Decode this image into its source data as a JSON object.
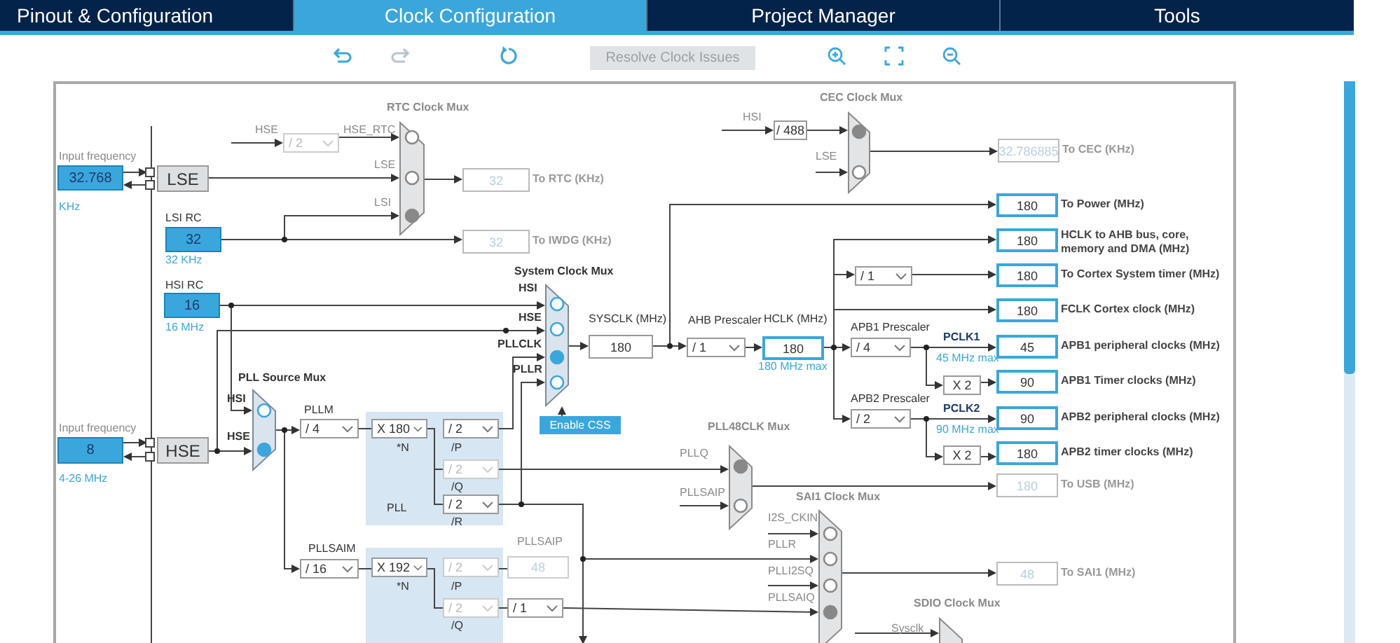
{
  "tabs": [
    {
      "label": "Pinout & Configuration",
      "selected": false
    },
    {
      "label": "Clock Configuration",
      "selected": true
    },
    {
      "label": "Project Manager",
      "selected": false
    },
    {
      "label": "Tools",
      "selected": false
    }
  ],
  "toolbar": {
    "resolve_button": {
      "label": "Resolve Clock Issues",
      "disabled": true
    }
  },
  "sources": [
    {
      "kind": "external",
      "title": "Input frequency",
      "value": "32.768",
      "unit": "KHz",
      "name": "LSE"
    },
    {
      "kind": "rc",
      "title": "LSI RC",
      "value": "32",
      "unit": "32 KHz"
    },
    {
      "kind": "rc",
      "title": "HSI RC",
      "value": "16",
      "unit": "16 MHz"
    },
    {
      "kind": "external",
      "title": "Input frequency",
      "value": "8",
      "unit": "4-26 MHz",
      "name": "HSE"
    }
  ],
  "muxes": [
    {
      "title": "RTC Clock Mux",
      "active": false,
      "inputs": [
        {
          "label": "HSE_RTC",
          "selected": false
        },
        {
          "label": "LSE",
          "selected": false
        },
        {
          "label": "LSI",
          "selected": true
        }
      ]
    },
    {
      "title": "CEC Clock Mux",
      "active": false,
      "inputs": [
        {
          "label": "HSI",
          "selected": true
        },
        {
          "label": "LSE",
          "selected": false
        }
      ]
    },
    {
      "title": "System Clock Mux",
      "active": true,
      "inputs": [
        {
          "label": "HSI",
          "selected": false
        },
        {
          "label": "HSE",
          "selected": false
        },
        {
          "label": "PLLCLK",
          "selected": true
        },
        {
          "label": "PLLR",
          "selected": false
        }
      ]
    },
    {
      "title": "PLL Source Mux",
      "active": true,
      "inputs": [
        {
          "label": "HSI",
          "selected": false
        },
        {
          "label": "HSE",
          "selected": true
        }
      ]
    },
    {
      "title": "PLL48CLK Mux",
      "active": false,
      "inputs": [
        {
          "label": "PLLQ",
          "selected": true
        },
        {
          "label": "PLLSAIP",
          "selected": false
        }
      ]
    },
    {
      "title": "SAI1 Clock Mux",
      "active": false,
      "inputs": [
        {
          "label": "I2S_CKIN",
          "selected": false
        },
        {
          "label": "PLLR",
          "selected": false
        },
        {
          "label": "PLLI2SQ",
          "selected": false
        },
        {
          "label": "PLLSAIQ",
          "selected": true
        }
      ]
    },
    {
      "title": "SDIO Clock Mux",
      "inputs": [
        {
          "label": "Sysclk"
        }
      ]
    }
  ],
  "dividers": [
    {
      "kind": "dropdown",
      "input_label": "HSE",
      "value": "/ 2",
      "disabled": true
    },
    {
      "kind": "fixed",
      "value": "/ 488",
      "disabled": false
    },
    {
      "kind": "dropdown",
      "title": "AHB Prescaler",
      "value": "/ 1",
      "disabled": false
    },
    {
      "kind": "dropdown",
      "value": "/ 1",
      "disabled": false
    },
    {
      "kind": "dropdown",
      "title": "APB1 Prescaler",
      "value": "/ 4",
      "disabled": false
    },
    {
      "kind": "dropdown",
      "title": "APB2 Prescaler",
      "value": "/ 2",
      "disabled": false
    },
    {
      "kind": "dropdown",
      "title": "PLLM",
      "value": "/ 4",
      "disabled": false
    },
    {
      "kind": "dropdown",
      "value": "X 180",
      "caption": "*N",
      "disabled": false
    },
    {
      "kind": "dropdown",
      "value": "/ 2",
      "caption": "/P",
      "disabled": false
    },
    {
      "kind": "dropdown",
      "value": "/ 2",
      "caption": "/Q",
      "disabled": true
    },
    {
      "kind": "dropdown",
      "value": "/ 2",
      "caption": "/R",
      "disabled": false
    },
    {
      "kind": "dropdown",
      "title": "PLLSAIM",
      "value": "/ 16",
      "disabled": false
    },
    {
      "kind": "dropdown",
      "value": "X 192",
      "caption": "*N",
      "disabled": false
    },
    {
      "kind": "dropdown",
      "value": "/ 2",
      "caption": "/P",
      "disabled": true
    },
    {
      "kind": "dropdown",
      "value": "/ 2",
      "caption": "/Q",
      "disabled": true
    },
    {
      "kind": "dropdown",
      "value": "/ 1",
      "disabled": false
    }
  ],
  "values": [
    {
      "title": "SYSCLK (MHz)",
      "value": "180",
      "highlighted": false,
      "disabled": false
    },
    {
      "title": "HCLK (MHz)",
      "value": "180",
      "note": "180 MHz max",
      "highlighted": true,
      "disabled": false
    },
    {
      "title": "PLLSAIP",
      "value": "48",
      "highlighted": false,
      "disabled": true
    }
  ],
  "pclk": [
    {
      "label": "PCLK1",
      "note": "45 MHz max"
    },
    {
      "label": "PCLK2",
      "note": "90 MHz max"
    }
  ],
  "multipliers": [
    "X 2",
    "X 2"
  ],
  "pll_label": "PLL",
  "enable_css": "Enable CSS",
  "outputs": [
    {
      "value": "32",
      "label": "To RTC (KHz)",
      "disabled": true
    },
    {
      "value": "32",
      "label": "To IWDG (KHz)",
      "disabled": true
    },
    {
      "value": "32.786885",
      "label": "To CEC (KHz)",
      "disabled": true
    },
    {
      "value": "180",
      "label": "To Power (MHz)",
      "disabled": false
    },
    {
      "value": "180",
      "label": "HCLK to AHB bus, core, memory and DMA (MHz)",
      "disabled": false
    },
    {
      "value": "180",
      "label": "To Cortex System timer (MHz)",
      "disabled": false
    },
    {
      "value": "180",
      "label": "FCLK Cortex clock (MHz)",
      "disabled": false
    },
    {
      "value": "45",
      "label": "APB1 peripheral clocks (MHz)",
      "disabled": false
    },
    {
      "value": "90",
      "label": "APB1 Timer clocks (MHz)",
      "disabled": false
    },
    {
      "value": "90",
      "label": "APB2 peripheral clocks (MHz)",
      "disabled": false
    },
    {
      "value": "180",
      "label": "APB2 timer clocks (MHz)",
      "disabled": false
    },
    {
      "value": "180",
      "label": "To USB (MHz)",
      "disabled": true
    },
    {
      "value": "48",
      "label": "To SAI1 (MHz)",
      "disabled": true
    }
  ]
}
